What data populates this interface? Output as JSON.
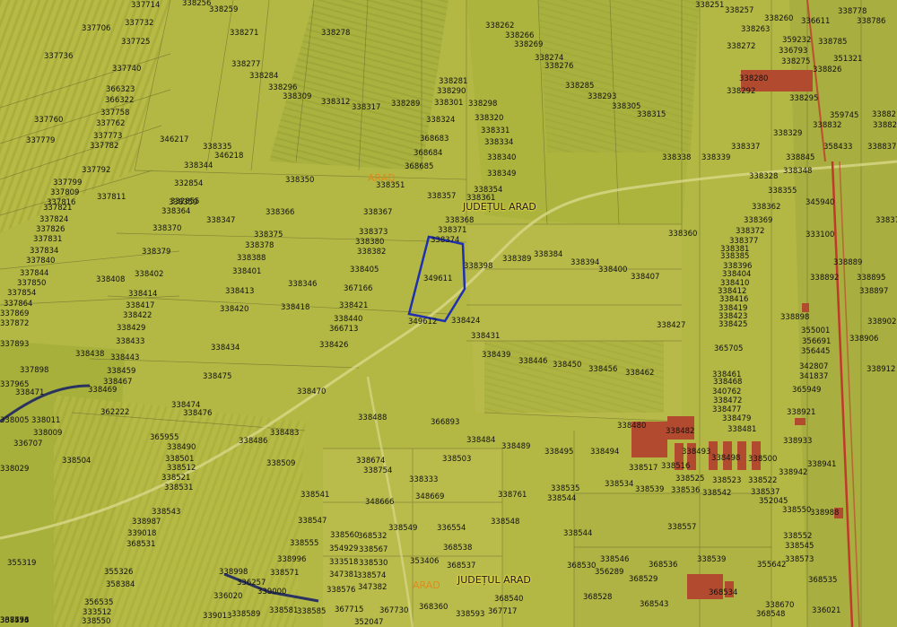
{
  "map": {
    "place_labels": [
      "ARAD",
      "ARAD"
    ],
    "county_labels": [
      "JUDEȚUL ARAD",
      "JUDEȚUL ARAD"
    ],
    "highlight_color": "#1f2fb0",
    "building_color": "#b24a2f",
    "road_color": "#c0392b",
    "parcels": [
      "338251",
      "338257",
      "338260",
      "336611",
      "338778",
      "338786",
      "337714",
      "338256",
      "338259",
      "338262",
      "338263",
      "338266",
      "338269",
      "338272",
      "359232",
      "338785",
      "337706",
      "337732",
      "337725",
      "338271",
      "338278",
      "336793",
      "338275",
      "351321",
      "337736",
      "338274",
      "338276",
      "338826",
      "337740",
      "338277",
      "338284",
      "338281",
      "338280",
      "338295",
      "366323",
      "338296",
      "338285",
      "338292",
      "366322",
      "338309",
      "338290",
      "338293",
      "337758",
      "338312",
      "338317",
      "338289",
      "338301",
      "338298",
      "338305",
      "359745",
      "338821",
      "337760",
      "338315",
      "338324",
      "338320",
      "338832",
      "338822",
      "337762",
      "338331",
      "346217",
      "338335",
      "368683",
      "338329",
      "337773",
      "337779",
      "346218",
      "338334",
      "338337",
      "358433",
      "338837",
      "337782",
      "368684",
      "338340",
      "338338",
      "338339",
      "338845",
      "338344",
      "368685",
      "337792",
      "338349",
      "338328",
      "338348",
      "338350",
      "338351",
      "337799",
      "332854",
      "338354",
      "338355",
      "337809",
      "332855",
      "338357",
      "338361",
      "345940",
      "337816",
      "338359",
      "338362",
      "337811",
      "337821",
      "338364",
      "338366",
      "338367",
      "338368",
      "338369",
      "338376",
      "337824",
      "338347",
      "337826",
      "338370",
      "338373",
      "338371",
      "338372",
      "338360",
      "333100",
      "337831",
      "338375",
      "338374",
      "338377",
      "338378",
      "338380",
      "338381",
      "337834",
      "338379",
      "338382",
      "338384",
      "338385",
      "338389",
      "338394",
      "338889",
      "337840",
      "338388",
      "338398",
      "338396",
      "337844",
      "338401",
      "338405",
      "338400",
      "338404",
      "338407",
      "338892",
      "338895",
      "337850",
      "338408",
      "338402",
      "349611",
      "338410",
      "337854",
      "338346",
      "338413",
      "367166",
      "338412",
      "338897",
      "337864",
      "338414",
      "338416",
      "338418",
      "338421",
      "338419",
      "338898",
      "338902",
      "337869",
      "338417",
      "338420",
      "338440",
      "338423",
      "337872",
      "338422",
      "338424",
      "349612",
      "338425",
      "338427",
      "355001",
      "337893",
      "338429",
      "366713",
      "338431",
      "365705",
      "356691",
      "338906",
      "338433",
      "338426",
      "338434",
      "338439",
      "356445",
      "338438",
      "338443",
      "338446",
      "338450",
      "338456",
      "342807",
      "338912",
      "337898",
      "338459",
      "338461",
      "341837",
      "338467",
      "338462",
      "338468",
      "337965",
      "338471",
      "338469",
      "338475",
      "338470",
      "340762",
      "365949",
      "338474",
      "338472",
      "338476",
      "338477",
      "362222",
      "338921",
      "338005",
      "338011",
      "338488",
      "366893",
      "338479",
      "338009",
      "338480",
      "338483",
      "338482",
      "338481",
      "338933",
      "338486",
      "338484",
      "338489",
      "338495",
      "338494",
      "338493",
      "338941",
      "336707",
      "365955",
      "338490",
      "338501",
      "338509",
      "338503",
      "338498",
      "338500",
      "338504",
      "338512",
      "338674",
      "338517",
      "338516",
      "338942",
      "338029",
      "338521",
      "338754",
      "338525",
      "338523",
      "338522",
      "338531",
      "338333",
      "338534",
      "338539",
      "338536",
      "338542",
      "338537",
      "338535",
      "338541",
      "348669",
      "338761",
      "338544",
      "352045",
      "338543",
      "348666",
      "338547",
      "338548",
      "338550",
      "338988",
      "338987",
      "338549",
      "336554",
      "338544",
      "338557",
      "338552",
      "339018",
      "338555",
      "338560",
      "368532",
      "368538",
      "338545",
      "338996",
      "354929",
      "338567",
      "368531",
      "368537",
      "353406",
      "338546",
      "338539",
      "355642",
      "338573",
      "355319",
      "338998",
      "333518",
      "338530",
      "368530",
      "368536",
      "356289",
      "355326",
      "336257",
      "338571",
      "347381",
      "338574",
      "368529",
      "368535",
      "358384",
      "339000",
      "338576",
      "347382",
      "368528",
      "368534",
      "336020",
      "356535",
      "338581",
      "338585",
      "367715",
      "367730",
      "368360",
      "368540",
      "368543",
      "338670",
      "336021",
      "333512",
      "339013",
      "338589",
      "338593",
      "367717",
      "368548",
      "338550",
      "352047",
      "338594",
      "367776",
      "338453",
      "338709",
      "338708",
      "336557"
    ]
  }
}
